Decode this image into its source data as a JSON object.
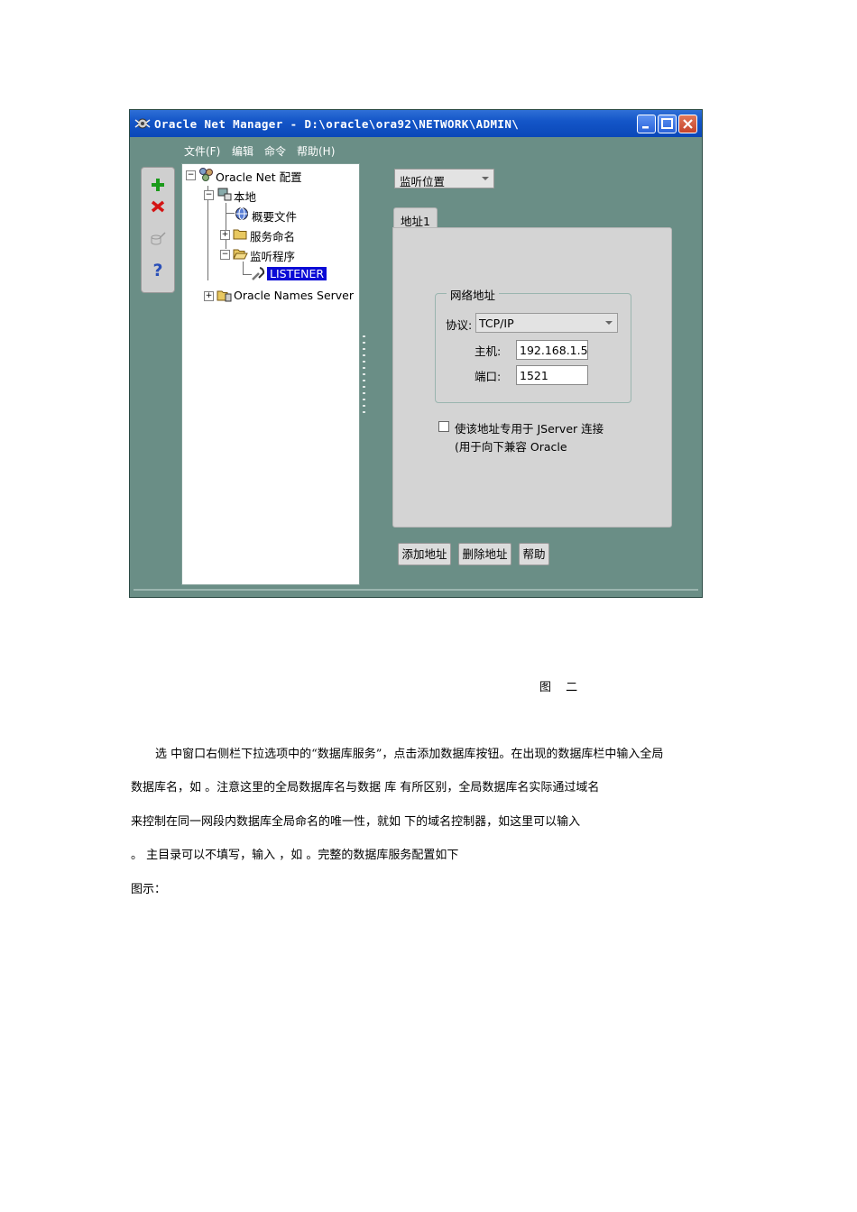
{
  "window": {
    "title": "Oracle Net Manager - D:\\oracle\\ora92\\NETWORK\\ADMIN\\",
    "menu": [
      "文件(F)",
      "编辑",
      "命令",
      "帮助(H)"
    ]
  },
  "toolbar": {
    "icons": [
      "add-icon",
      "delete-icon",
      "test-icon",
      "help-icon"
    ]
  },
  "tree": {
    "root": "Oracle Net 配置",
    "local": "本地",
    "profile": "概要文件",
    "service_naming": "服务命名",
    "listeners": "监听程序",
    "listener": "LISTENER",
    "names_server": "Oracle Names Server"
  },
  "right_panel": {
    "view_select": "监听位置",
    "tab": "地址1",
    "group_title": "网络地址",
    "protocol_label": "协议:",
    "protocol_value": "TCP/IP",
    "host_label": "主机:",
    "host_value": "192.168.1.5",
    "port_label": "端口:",
    "port_value": "1521",
    "checkbox_line1": "使该地址专用于 JServer 连接",
    "checkbox_line2": "(用于向下兼容 Oracle",
    "checkbox_checked": false,
    "buttons": {
      "add": "添加地址",
      "remove": "删除地址",
      "help": "帮助"
    }
  },
  "document": {
    "caption": "图 二",
    "lines": [
      "选  中窗口右侧栏下拉选项中的“数据库服务”，点击添加数据库按钮。在出现的数据库栏中输入全局",
      "数据库名，如              。注意这里的全局数据库名与数据  库        有所区别，全局数据库名实际通过域名",
      "来控制在同一网段内数据库全局命名的唯一性，就如                下的域名控制器，如这里可以输入",
      "                                    。           主目录可以不填写，输入      ，如                。完整的数据库服务配置如下",
      "图示："
    ]
  }
}
